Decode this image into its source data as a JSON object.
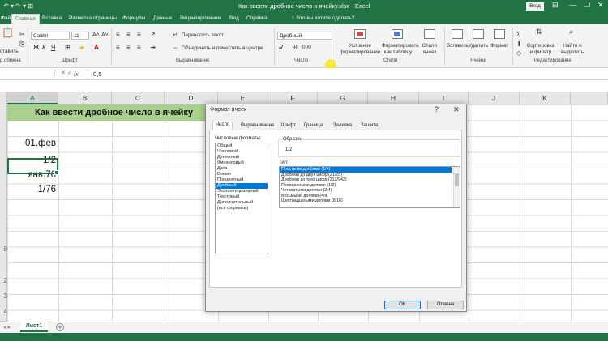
{
  "titlebar": {
    "quick_access": "↶ ▾ ↷ ▾ ⊞",
    "title": "Как ввести дробное число в ячейку.xlsx  -  Excel",
    "login": "Вход",
    "min": "—",
    "restore": "❐",
    "close": "✕",
    "ribbon_toggle": "⊟"
  },
  "tabs": {
    "file": "Файл",
    "items": [
      "Главная",
      "Вставка",
      "Разметка страницы",
      "Формулы",
      "Данные",
      "Рецензирование",
      "Вид",
      "Справка"
    ],
    "tell_me": "♀  Что вы хотите сделать?"
  },
  "ribbon": {
    "clipboard_paste": "ставить",
    "clipboard_label": "р обмена",
    "font_name": "Calibri",
    "font_size": "11",
    "font_label": "Шрифт",
    "bold": "Ж",
    "italic": "К",
    "underline": "Ч",
    "grow": "A˄",
    "shrink": "A˅",
    "wrap_text": "Переносить текст",
    "merge_center": "Объединить и поместить в центре",
    "align_label": "Выравнивание",
    "number_format": "Дробный",
    "number_label": "Число",
    "percent": "%",
    "thousands": "000",
    "conditional": "Условное форматирование",
    "format_table": "Форматировать как таблицу",
    "cell_styles": "Стили ячеек",
    "styles_label": "Стили",
    "insert": "Вставить",
    "delete": "Удалить",
    "format": "Формат",
    "cells_label": "Ячейки",
    "sum": "Σ",
    "sort_filter": "Сортировка и фильтр",
    "find_select": "Найти и выделить",
    "editing_label": "Редактирование"
  },
  "formula_bar": {
    "fx": "fx",
    "value": "0,5"
  },
  "sheet": {
    "columns": [
      "A",
      "B",
      "C",
      "D",
      "E",
      "F",
      "G",
      "H",
      "I",
      "J",
      "K"
    ],
    "banner": "Как ввести дробное число в ячейку",
    "cells": [
      "01.фев",
      "1/2",
      "янв.76",
      "1/76"
    ],
    "row_labels": [
      "0",
      "2",
      "3",
      "4"
    ]
  },
  "sheet_tabs": {
    "nav": "◂ ▸",
    "active": "Лист1",
    "add": "+"
  },
  "dialog": {
    "title": "Формат ячеек",
    "help": "?",
    "close": "✕",
    "tabs": [
      "Число",
      "Выравнивание",
      "Шрифт",
      "Граница",
      "Заливка",
      "Защита"
    ],
    "category_label": "Числовые форматы:",
    "categories": [
      "Общий",
      "Числовой",
      "Денежный",
      "Финансовый",
      "Дата",
      "Время",
      "Процентный",
      "Дробный",
      "Экспоненциальный",
      "Текстовый",
      "Дополнительный",
      "(все форматы)"
    ],
    "selected_category": "Дробный",
    "sample_label": "Образец",
    "sample_value": "1/2",
    "type_label": "Тип:",
    "types": [
      "Простыми дробями (1/4)",
      "Дробями до двух цифр (21/25)",
      "Дробями до трех цифр (312/943)",
      "Половинными долями (1/2)",
      "Четвертыми долями (2/4)",
      "Восьмыми долями (4/8)",
      "Шестнадцатыми долями (8/16)"
    ],
    "selected_type": "Простыми дробями (1/4)",
    "ok": "OK",
    "cancel": "Отмена"
  }
}
